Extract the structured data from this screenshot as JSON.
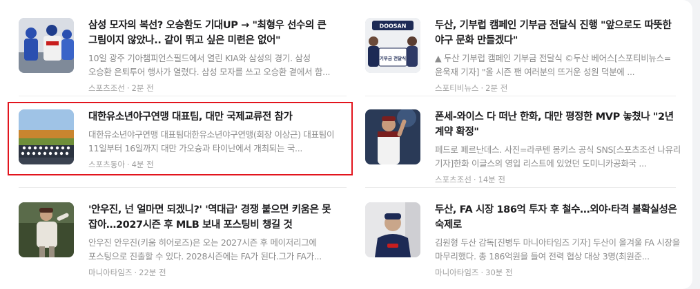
{
  "articles": [
    {
      "title": "삼성 모자의 복선? 오승환도 기대UP → \"최형우 선수의 큰 그림이지 않았나.. 같이 뛰고 싶은 미련은 없어\"",
      "summary": "10일 광주 기아챔피언스필드에서 열린 KIA와 삼성의 경기. 삼성 오승환 은퇴투어 행사가 열렸다. 삼성 모자를 쓰고 오승환 곁에서 함...",
      "source": "스포츠조선",
      "time": "2분 전"
    },
    {
      "title": "두산, 기부럽 캠페인 기부금 전달식 진행 \"앞으로도 따뜻한 야구 문화 만들겠다\"",
      "summary": "▲ 두산 기부럽 캠페인 기부금 전달식 ©두산 베어스[스포티비뉴스=윤욱재 기자] \"올 시즌 팬 여러분의 뜨거운 성원 덕분에 ...",
      "source": "스포티비뉴스",
      "time": "2분 전"
    },
    {
      "title": "대한유소년야구연맹 대표팀, 대만 국제교류전 참가",
      "summary": "대한유소년야구연맹 대표팀대한유소년야구연맹(회장 이상근) 대표팀이 11일부터 16일까지 대만 가오슝과 타이난에서 개최되는 국...",
      "source": "스포츠동아",
      "time": "4분 전"
    },
    {
      "title": "폰세-와이스 다 떠난 한화, 대만 평정한 MVP 놓쳤나 \"2년 계약 확정\"",
      "summary": "페드로 페르난데스. 사진=라쿠텐 몽키스 공식 SNS[스포츠조선 나유리 기자]한화 이글스의 영입 리스트에 있었던 도미니카공화국 ...",
      "source": "스포츠조선",
      "time": "14분 전"
    },
    {
      "title": "'안우진, 넌 얼마면 되겠니?' '역대급' 경쟁 붙으면 키움은 못 잡아…2027시즌 후 MLB 보내 포스팅비 챙길 것",
      "summary": "안우진 안우진(키움 히어로즈)은 오는 2027시즌 후 메이저리그에 포스팅으로 진출할 수 있다. 2028시즌에는 FA가 된다.그가 FA가...",
      "source": "마니아타임즈",
      "time": "22분 전"
    },
    {
      "title": "두산, FA 시장 186억 투자 후 철수…외야·타격 불확실성은 숙제로",
      "summary": "김원형 두산 감독[진병두 마니아타임즈 기자] 두산이 올겨울 FA 시장을 마무리했다. 총 186억원을 들여 전력 협상 대상 3명(최원준...",
      "source": "마니아타임즈",
      "time": "30분 전"
    }
  ],
  "thumb_logos": {
    "banner": "DOOSAN",
    "board": "기부금 전달식"
  },
  "colors": {
    "highlight": "#e2141d",
    "title": "#1d1d1f",
    "muted": "#8c8c8c"
  }
}
